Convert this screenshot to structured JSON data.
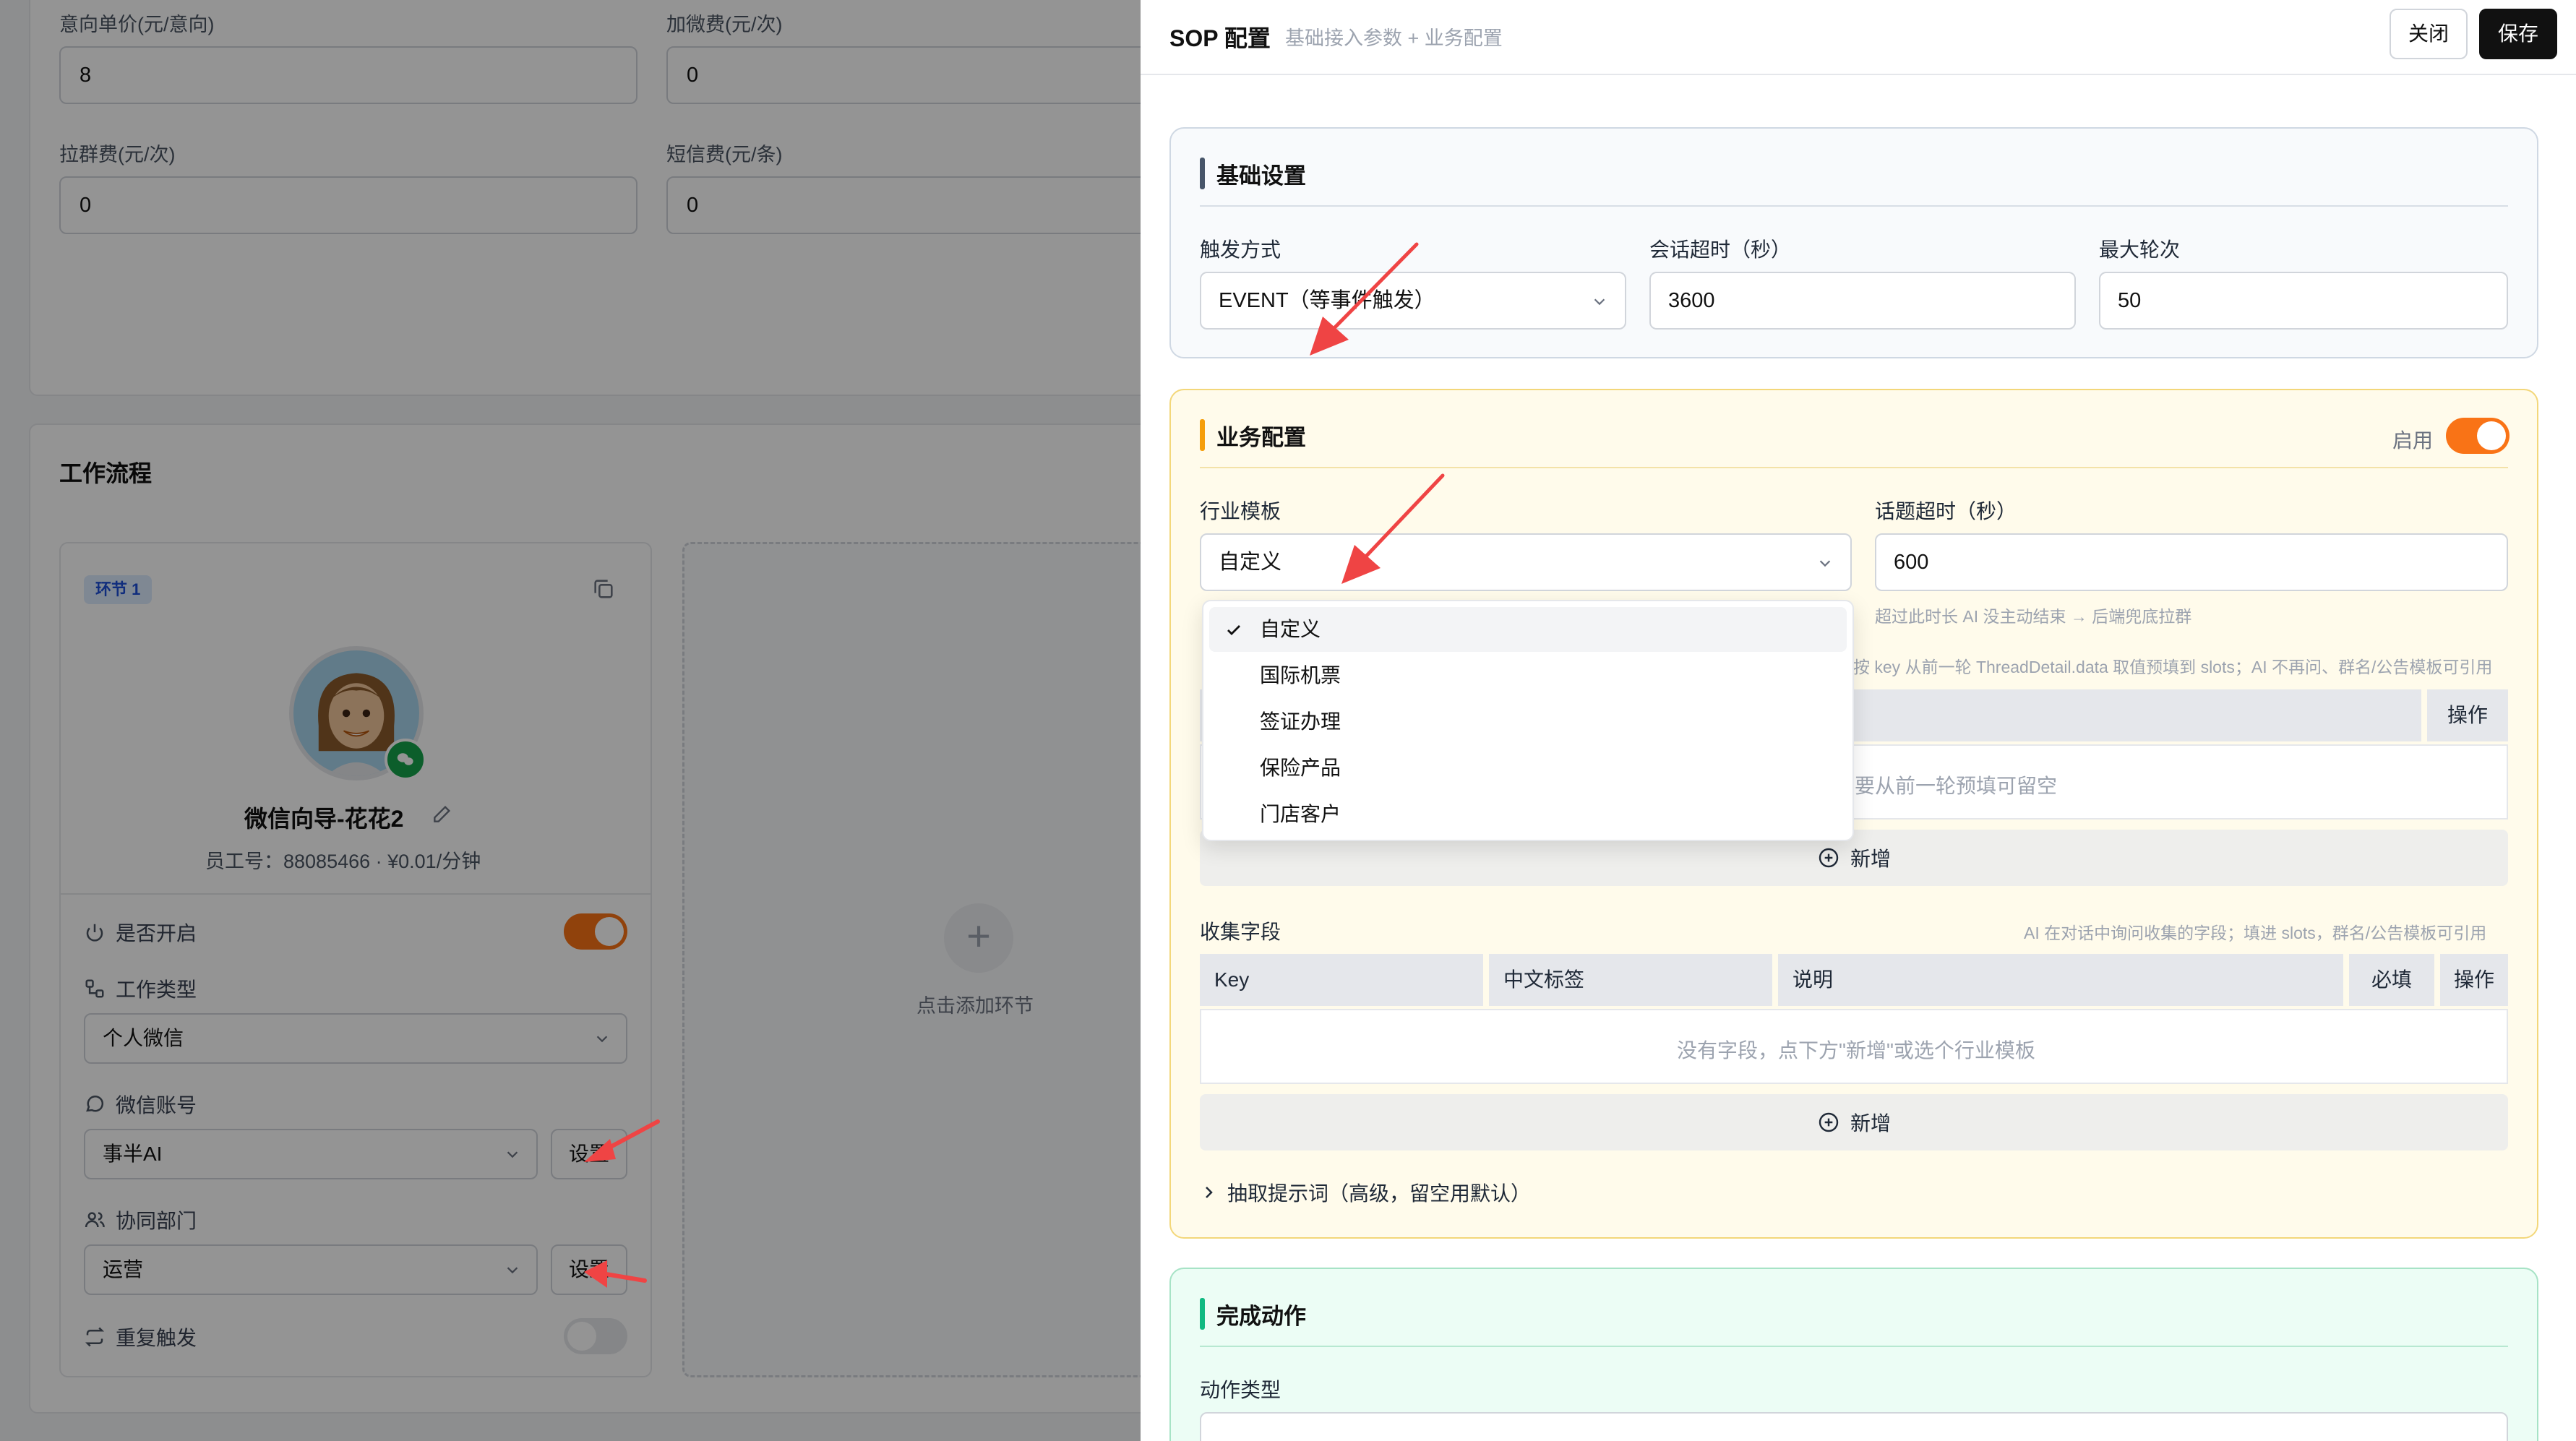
{
  "background": {
    "fields": [
      {
        "label": "意向单价(元/意向)",
        "value": "8"
      },
      {
        "label": "加微费(元/次)",
        "value": "0"
      },
      {
        "label": "拉群费(元/次)",
        "value": "0"
      },
      {
        "label": "短信费(元/条)",
        "value": "0"
      }
    ],
    "workflow": {
      "title": "工作流程",
      "node": {
        "badge": "环节 1",
        "name": "微信向导-花花2",
        "meta": "员工号：88085466 · ¥0.01/分钟",
        "enabled_label": "是否开启",
        "work_type_label": "工作类型",
        "work_type_value": "个人微信",
        "wechat_label": "微信账号",
        "wechat_value": "事半AI",
        "dept_label": "协同部门",
        "dept_value": "运营",
        "set_label": "设置",
        "repeat_label": "重复触发"
      },
      "add_node_label": "点击添加环节"
    }
  },
  "drawer": {
    "title": "SOP 配置",
    "subtitle": "基础接入参数 + 业务配置",
    "close_label": "关闭",
    "save_label": "保存",
    "basic": {
      "title": "基础设置",
      "trigger_label": "触发方式",
      "trigger_value": "EVENT（等事件触发）",
      "timeout_label": "会话超时（秒）",
      "timeout_value": "3600",
      "rounds_label": "最大轮次",
      "rounds_value": "50"
    },
    "business": {
      "title": "业务配置",
      "enable_label": "启用",
      "enabled": true,
      "template_label": "行业模板",
      "template_value": "自定义",
      "topic_timeout_label": "话题超时（秒）",
      "topic_timeout_value": "600",
      "topic_hint": "超过此时长 AI 没主动结束 → 后端兜底拉群",
      "slots_hint_partial": "按 key 从前一轮 ThreadDetail.data 取值预填到 slots；AI 不再问、群名/公告模板可引用",
      "op_label": "操作",
      "prefill_empty_partial": "要从前一轮预填可留空",
      "add_label": "新增",
      "collect_label": "收集字段",
      "collect_hint": "AI 在对话中询问收集的字段；填进 slots，群名/公告模板可引用",
      "collect_columns": [
        "Key",
        "中文标签",
        "说明",
        "必填",
        "操作"
      ],
      "collect_empty": "没有字段，点下方\"新增\"或选个行业模板",
      "advanced_label": "抽取提示词（高级，留空用默认）",
      "template_options": [
        "自定义",
        "国际机票",
        "签证办理",
        "保险产品",
        "门店客户"
      ],
      "template_selected_index": 0
    },
    "done": {
      "title": "完成动作",
      "action_type_label": "动作类型"
    }
  },
  "colors": {
    "accent_orange": "#f97316",
    "save_button": "#111111",
    "annotation_arrow": "#ef4444",
    "basic_bar": "#475569",
    "business_bar": "#f59e0b",
    "done_bar": "#10b981"
  }
}
